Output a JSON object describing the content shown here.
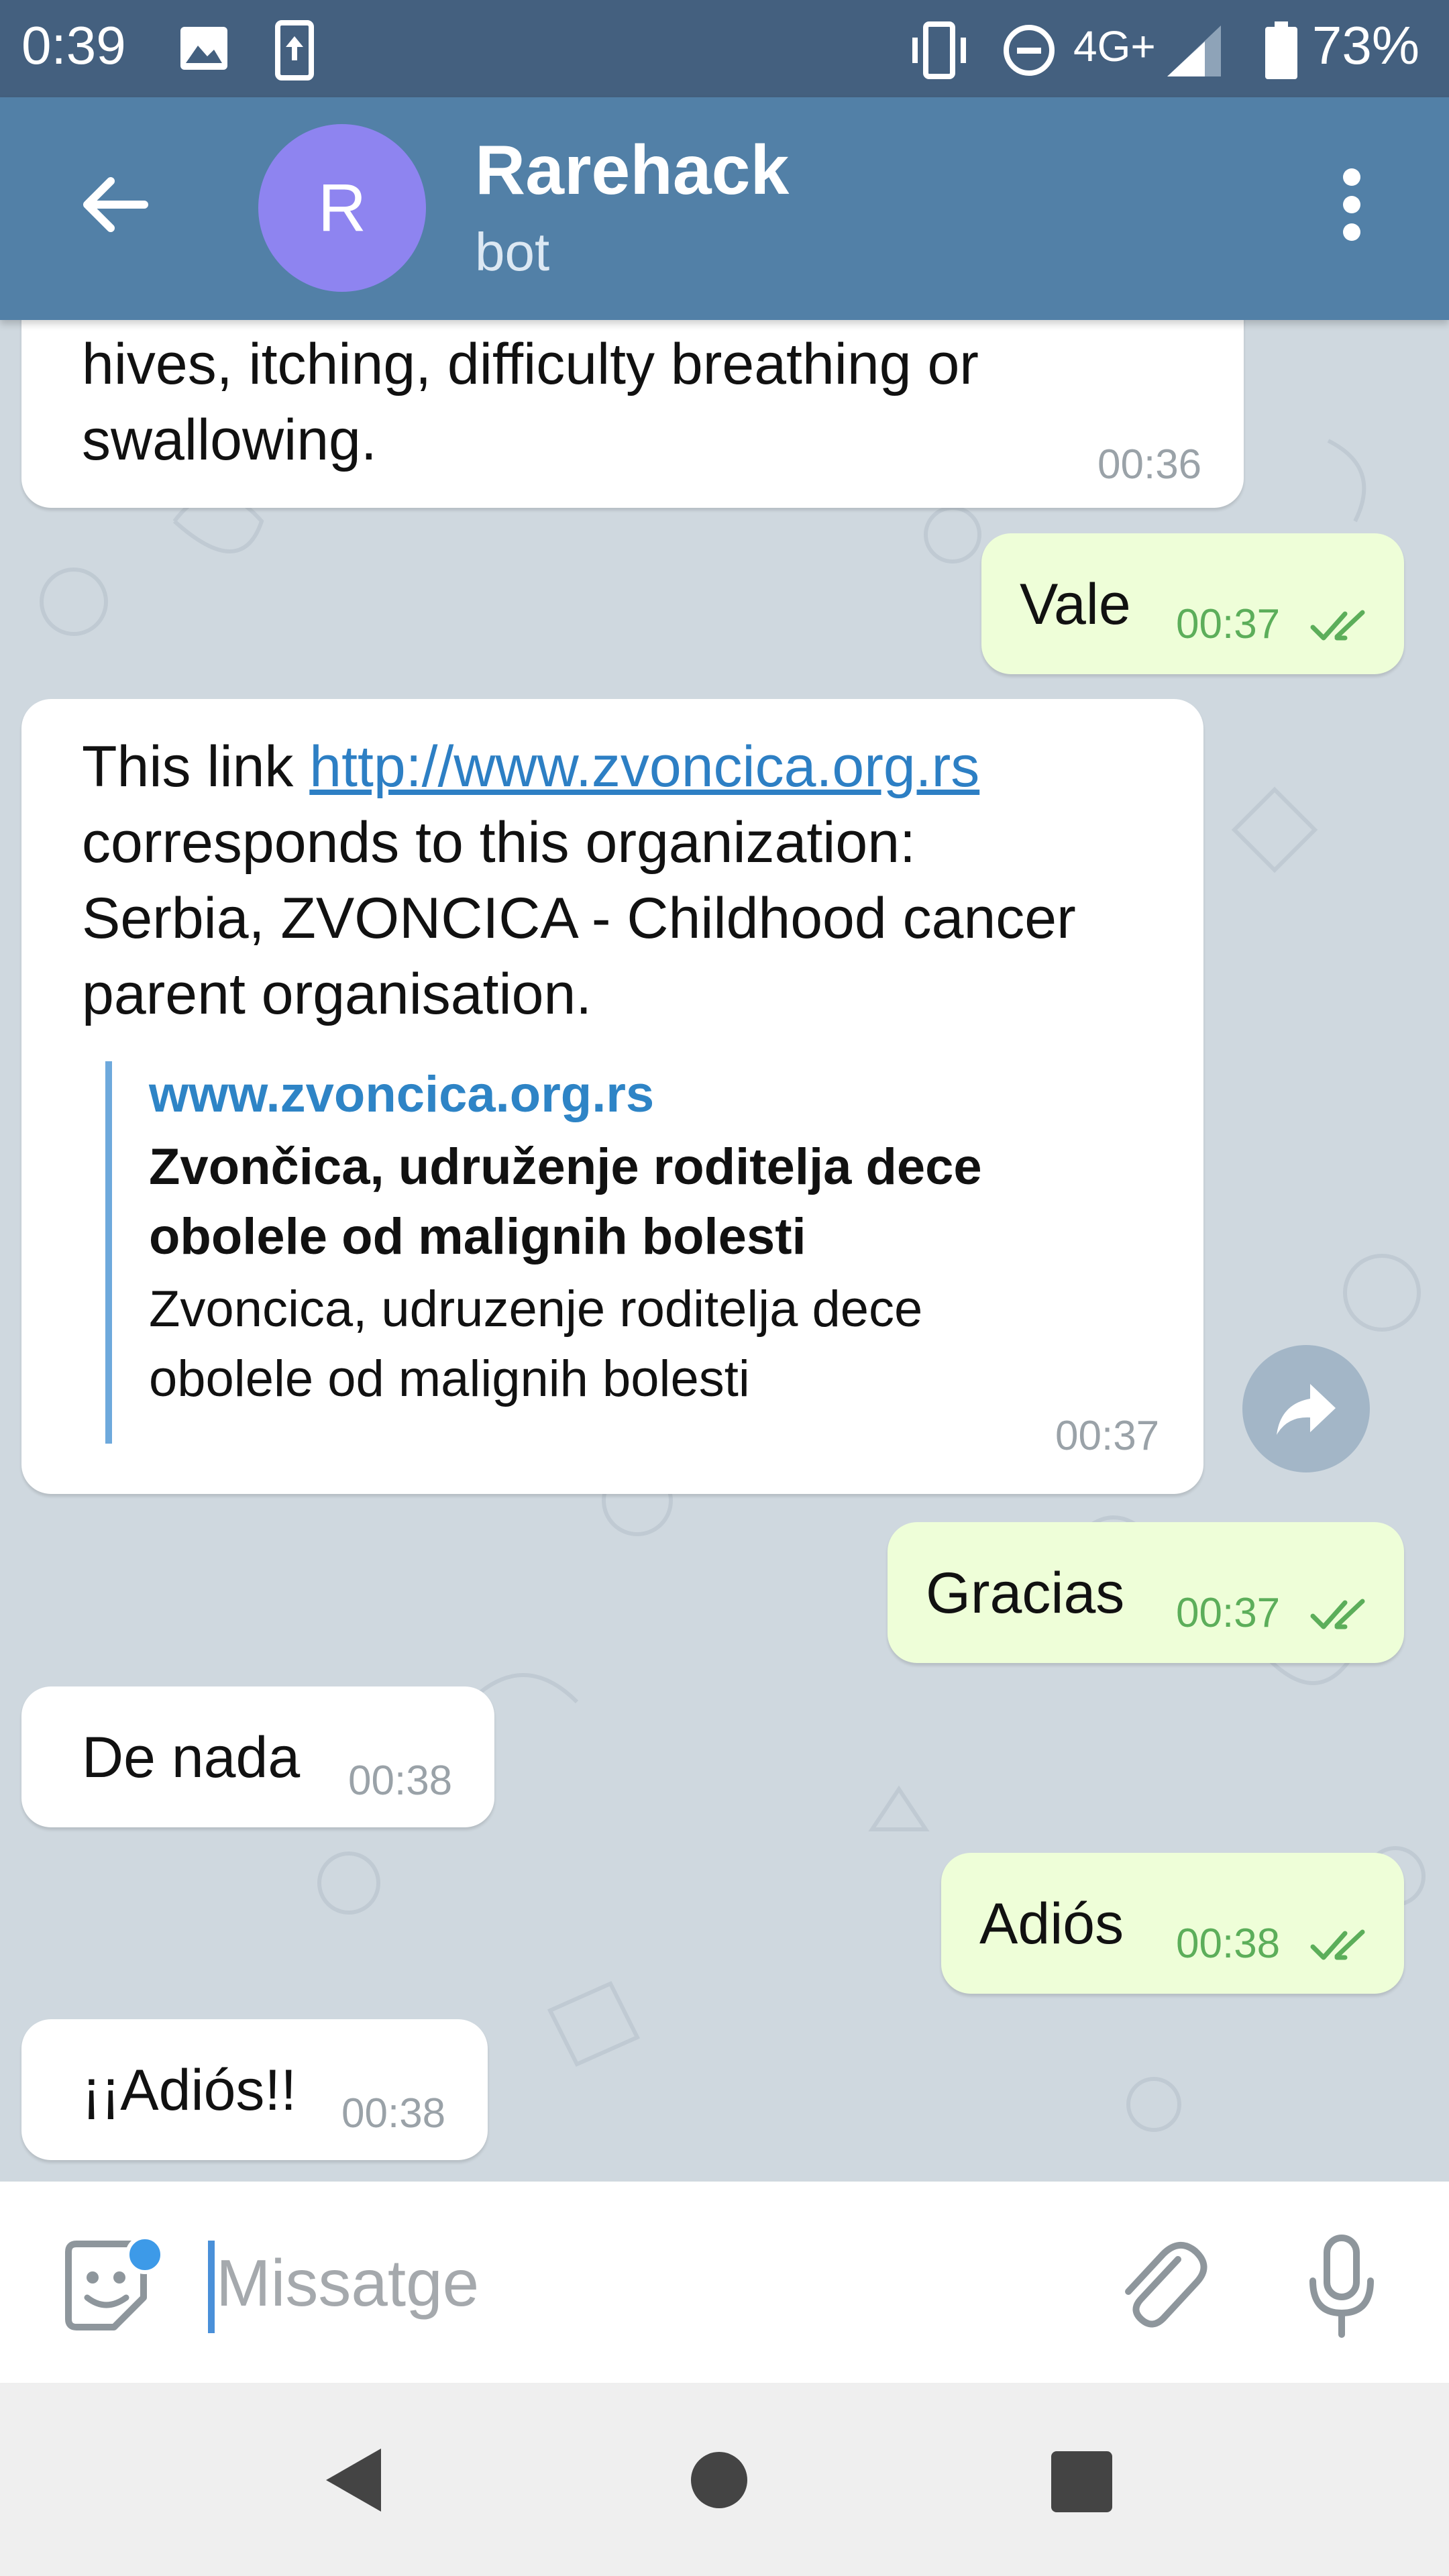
{
  "status_bar": {
    "time": "0:39",
    "network": "4G+",
    "battery": "73%"
  },
  "header": {
    "avatar_letter": "R",
    "title": "Rarehack",
    "subtitle": "bot"
  },
  "messages": [
    {
      "direction": "in",
      "text_lines": [
        "hives, itching, difficulty breathing or",
        "swallowing."
      ],
      "time": "00:36"
    },
    {
      "direction": "out",
      "text": "Vale",
      "time": "00:37"
    },
    {
      "direction": "in",
      "text_before_link": "This link ",
      "link": "http://www.zvoncica.org.rs",
      "text_lines": [
        "corresponds to this organization:",
        "Serbia, ZVONCICA - Childhood cancer",
        "parent organisation."
      ],
      "preview": {
        "site": "www.zvoncica.org.rs",
        "title_lines": [
          "Zvončica, udruženje roditelja dece",
          "obolele od malignih bolesti"
        ],
        "desc_lines": [
          "Zvoncica, udruzenje roditelja dece",
          "obolele od malignih bolesti"
        ]
      },
      "time": "00:37"
    },
    {
      "direction": "out",
      "text": "Gracias",
      "time": "00:37"
    },
    {
      "direction": "in",
      "text": "De nada",
      "time": "00:38"
    },
    {
      "direction": "out",
      "text": "Adiós",
      "time": "00:38"
    },
    {
      "direction": "in",
      "text": "¡¡Adiós!!",
      "time": "00:38"
    }
  ],
  "input": {
    "placeholder": "Missatge"
  },
  "colors": {
    "header": "#5280a7",
    "status_bar": "#44607f",
    "chat_background": "#cfd8df",
    "outgoing_bubble": "#eefed8",
    "incoming_bubble": "#ffffff",
    "avatar": "#8e84f0",
    "read_check": "#5cae5a",
    "link": "#2d7fc4"
  }
}
